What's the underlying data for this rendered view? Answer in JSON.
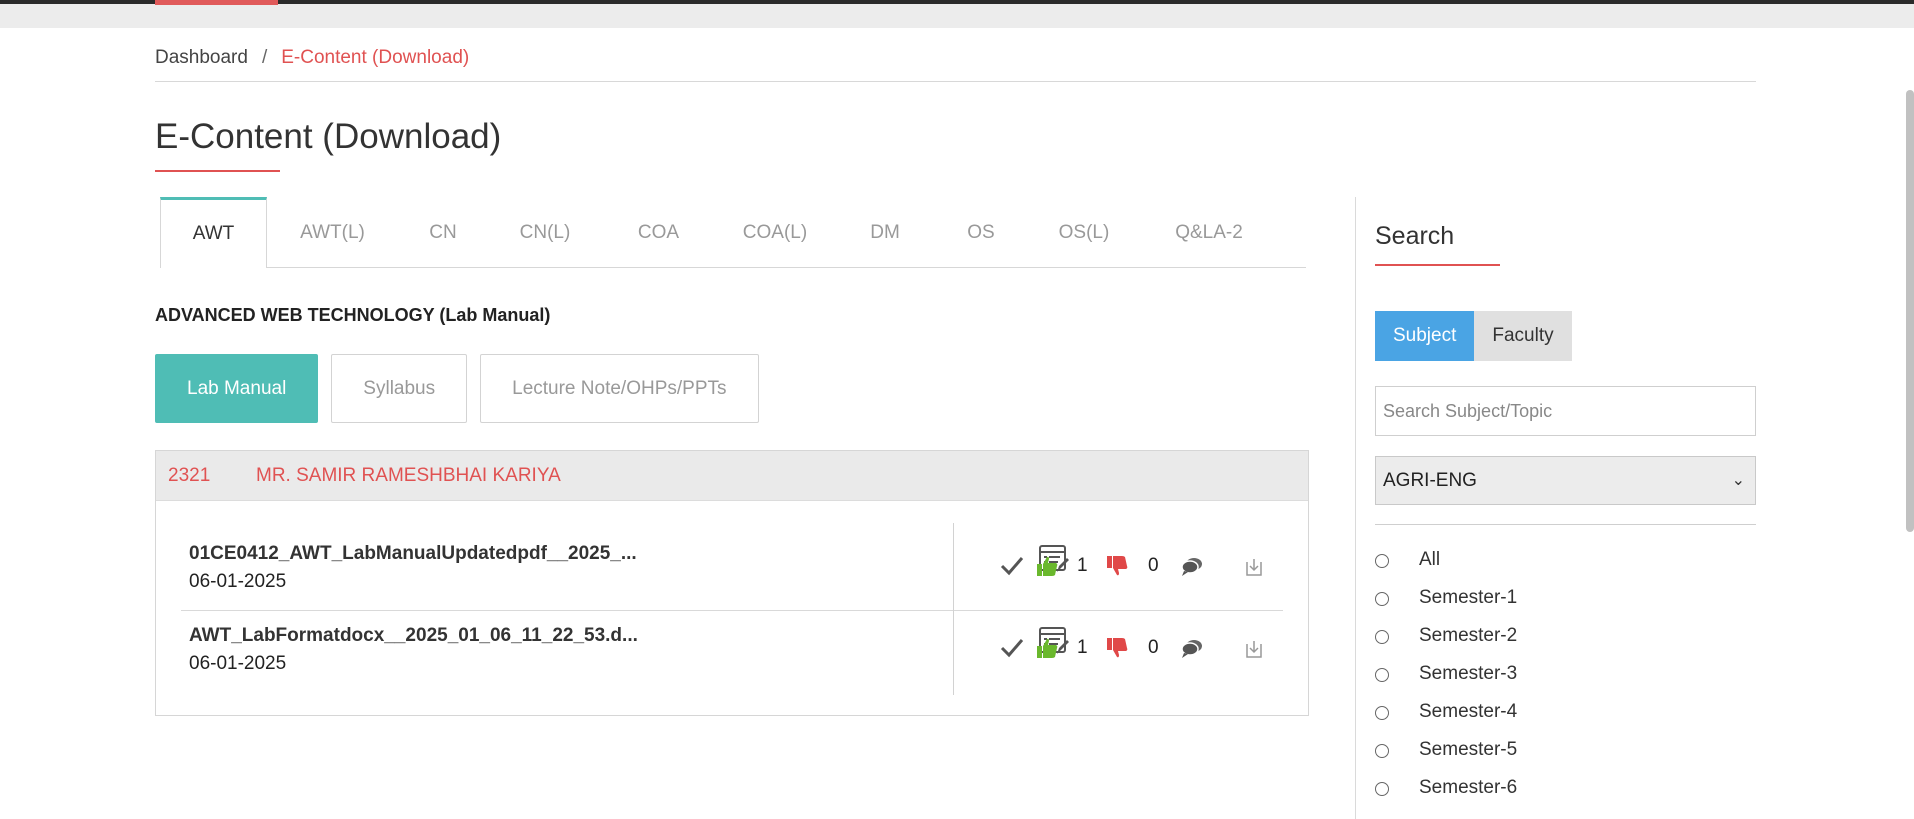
{
  "breadcrumb": {
    "home": "Dashboard",
    "separator": "/",
    "current": "E-Content (Download)"
  },
  "page": {
    "title": "E-Content (Download)"
  },
  "tabs": [
    {
      "label": "AWT",
      "active": true
    },
    {
      "label": "AWT(L)"
    },
    {
      "label": "CN"
    },
    {
      "label": "CN(L)"
    },
    {
      "label": "COA"
    },
    {
      "label": "COA(L)"
    },
    {
      "label": "DM"
    },
    {
      "label": "OS"
    },
    {
      "label": "OS(L)"
    },
    {
      "label": "Q&LA-2"
    }
  ],
  "subject": {
    "title": "ADVANCED WEB TECHNOLOGY (Lab Manual)"
  },
  "content_types": [
    {
      "label": "Lab Manual",
      "active": true
    },
    {
      "label": "Syllabus"
    },
    {
      "label": "Lecture Note/OHPs/PPTs"
    }
  ],
  "faculty": {
    "id": "2321",
    "name": "MR. SAMIR RAMESHBHAI KARIYA"
  },
  "files": [
    {
      "name": "01CE0412_AWT_LabManualUpdatedpdf__2025_...",
      "date": "06-01-2025",
      "likes": "1",
      "dislikes": "0"
    },
    {
      "name": "AWT_LabFormatdocx__2025_01_06_11_22_53.d...",
      "date": "06-01-2025",
      "likes": "1",
      "dislikes": "0"
    }
  ],
  "search": {
    "title": "Search",
    "modes": [
      {
        "label": "Subject",
        "active": true
      },
      {
        "label": "Faculty"
      }
    ],
    "placeholder": "Search Subject/Topic",
    "department": "AGRI-ENG",
    "filters": [
      "All",
      "Semester-1",
      "Semester-2",
      "Semester-3",
      "Semester-4",
      "Semester-5",
      "Semester-6"
    ]
  },
  "colors": {
    "accent_red": "#e05252",
    "teal": "#4fbdb5",
    "blue": "#4aa4e4",
    "like_green": "#6ab82d",
    "dislike_red": "#e04848"
  }
}
